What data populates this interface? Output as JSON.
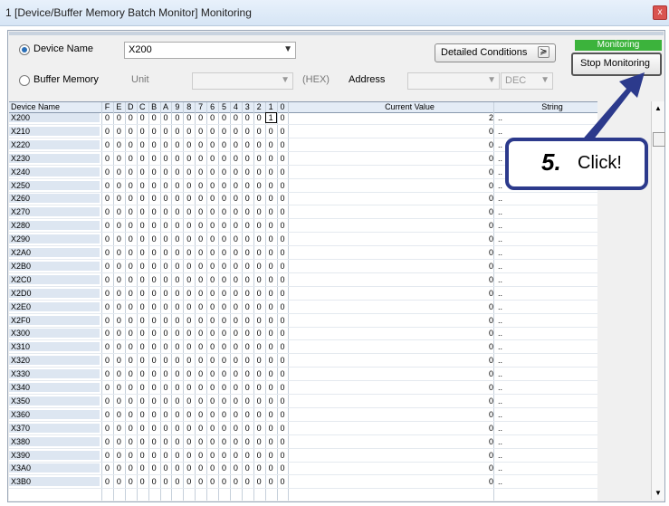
{
  "window": {
    "title": "1 [Device/Buffer Memory Batch Monitor] Monitoring",
    "close_glyph": "x"
  },
  "form": {
    "device_name_label": "Device Name",
    "device_name_value": "X200",
    "buffer_memory_label": "Buffer Memory",
    "unit_label": "Unit",
    "hex_label": "(HEX)",
    "address_label": "Address",
    "dec_value": "DEC",
    "detailed_conditions": "Detailed Conditions",
    "status": "Monitoring",
    "stop_button": "Stop Monitoring"
  },
  "table": {
    "headers": {
      "device_name": "Device Name",
      "bits": [
        "F",
        "E",
        "D",
        "C",
        "B",
        "A",
        "9",
        "8",
        "7",
        "6",
        "5",
        "4",
        "3",
        "2",
        "1",
        "0"
      ],
      "current_value": "Current Value",
      "string": "String"
    },
    "rows": [
      {
        "device": "X200",
        "bits": "0000000000000010",
        "value": "2",
        "string": ".."
      },
      {
        "device": "X210",
        "bits": "0000000000000000",
        "value": "0",
        "string": ".."
      },
      {
        "device": "X220",
        "bits": "0000000000000000",
        "value": "0",
        "string": ".."
      },
      {
        "device": "X230",
        "bits": "0000000000000000",
        "value": "0",
        "string": ".."
      },
      {
        "device": "X240",
        "bits": "0000000000000000",
        "value": "0",
        "string": ".."
      },
      {
        "device": "X250",
        "bits": "0000000000000000",
        "value": "0",
        "string": ".."
      },
      {
        "device": "X260",
        "bits": "0000000000000000",
        "value": "0",
        "string": ".."
      },
      {
        "device": "X270",
        "bits": "0000000000000000",
        "value": "0",
        "string": ".."
      },
      {
        "device": "X280",
        "bits": "0000000000000000",
        "value": "0",
        "string": ".."
      },
      {
        "device": "X290",
        "bits": "0000000000000000",
        "value": "0",
        "string": ".."
      },
      {
        "device": "X2A0",
        "bits": "0000000000000000",
        "value": "0",
        "string": ".."
      },
      {
        "device": "X2B0",
        "bits": "0000000000000000",
        "value": "0",
        "string": ".."
      },
      {
        "device": "X2C0",
        "bits": "0000000000000000",
        "value": "0",
        "string": ".."
      },
      {
        "device": "X2D0",
        "bits": "0000000000000000",
        "value": "0",
        "string": ".."
      },
      {
        "device": "X2E0",
        "bits": "0000000000000000",
        "value": "0",
        "string": ".."
      },
      {
        "device": "X2F0",
        "bits": "0000000000000000",
        "value": "0",
        "string": ".."
      },
      {
        "device": "X300",
        "bits": "0000000000000000",
        "value": "0",
        "string": ".."
      },
      {
        "device": "X310",
        "bits": "0000000000000000",
        "value": "0",
        "string": ".."
      },
      {
        "device": "X320",
        "bits": "0000000000000000",
        "value": "0",
        "string": ".."
      },
      {
        "device": "X330",
        "bits": "0000000000000000",
        "value": "0",
        "string": ".."
      },
      {
        "device": "X340",
        "bits": "0000000000000000",
        "value": "0",
        "string": ".."
      },
      {
        "device": "X350",
        "bits": "0000000000000000",
        "value": "0",
        "string": ".."
      },
      {
        "device": "X360",
        "bits": "0000000000000000",
        "value": "0",
        "string": ".."
      },
      {
        "device": "X370",
        "bits": "0000000000000000",
        "value": "0",
        "string": ".."
      },
      {
        "device": "X380",
        "bits": "0000000000000000",
        "value": "0",
        "string": ".."
      },
      {
        "device": "X390",
        "bits": "0000000000000000",
        "value": "0",
        "string": ".."
      },
      {
        "device": "X3A0",
        "bits": "0000000000000000",
        "value": "0",
        "string": ".."
      },
      {
        "device": "X3B0",
        "bits": "0000000000000000",
        "value": "0",
        "string": ".."
      }
    ]
  },
  "callout": {
    "step": "5.",
    "text": "Click!"
  },
  "colors": {
    "accent": "#2c3a8c",
    "status_green": "#3cb33c"
  }
}
